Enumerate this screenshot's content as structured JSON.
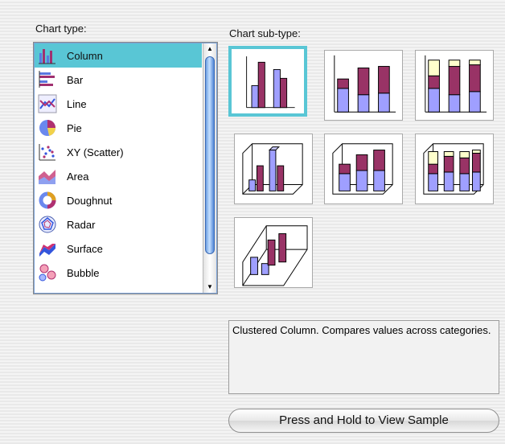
{
  "labels": {
    "chart_type": "Chart type:",
    "chart_subtype": "Chart sub-type:"
  },
  "chart_types": [
    {
      "label": "Column",
      "icon": "column-chart-icon",
      "selected": true
    },
    {
      "label": "Bar",
      "icon": "bar-chart-icon",
      "selected": false
    },
    {
      "label": "Line",
      "icon": "line-chart-icon",
      "selected": false
    },
    {
      "label": "Pie",
      "icon": "pie-chart-icon",
      "selected": false
    },
    {
      "label": "XY (Scatter)",
      "icon": "scatter-chart-icon",
      "selected": false
    },
    {
      "label": "Area",
      "icon": "area-chart-icon",
      "selected": false
    },
    {
      "label": "Doughnut",
      "icon": "doughnut-chart-icon",
      "selected": false
    },
    {
      "label": "Radar",
      "icon": "radar-chart-icon",
      "selected": false
    },
    {
      "label": "Surface",
      "icon": "surface-chart-icon",
      "selected": false
    },
    {
      "label": "Bubble",
      "icon": "bubble-chart-icon",
      "selected": false
    }
  ],
  "subtypes": [
    {
      "name": "clustered-column",
      "selected": true
    },
    {
      "name": "stacked-column",
      "selected": false
    },
    {
      "name": "100-percent-stacked-column",
      "selected": false
    },
    {
      "name": "3d-clustered-column",
      "selected": false
    },
    {
      "name": "3d-stacked-column",
      "selected": false
    },
    {
      "name": "3d-100-percent-stacked-column",
      "selected": false
    },
    {
      "name": "3d-column",
      "selected": false
    }
  ],
  "description": "Clustered Column. Compares values across categories.",
  "button": {
    "sample_label": "Press and Hold to View Sample"
  },
  "colors": {
    "selection": "#59c6d5",
    "series_blue": "#9f9fff",
    "series_maroon": "#993366",
    "series_cream": "#ffffcc"
  }
}
